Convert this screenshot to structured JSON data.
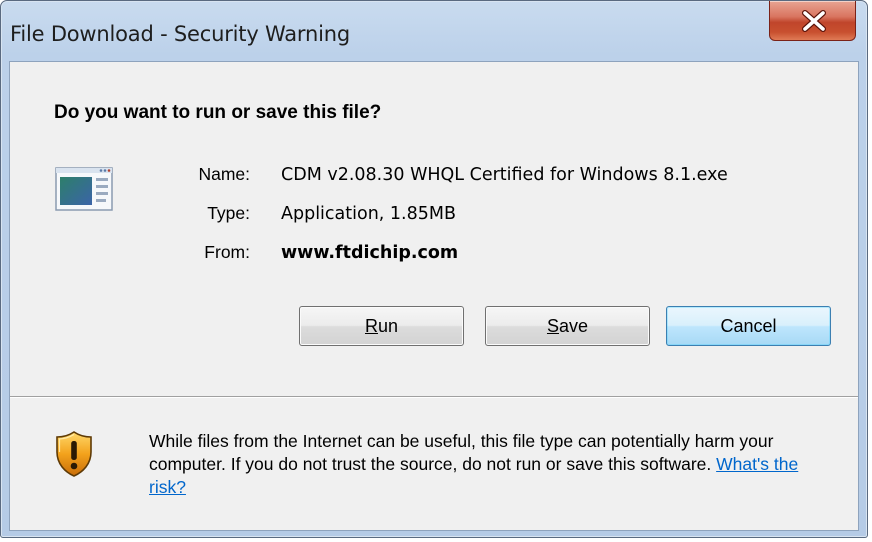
{
  "window": {
    "title": "File Download - Security Warning"
  },
  "dialog": {
    "question": "Do you want to run or save this file?",
    "fields": {
      "name_label": "Name:",
      "name_value": "CDM v2.08.30 WHQL Certified for Windows 8.1.exe",
      "type_label": "Type:",
      "type_value": "Application, 1.85MB",
      "from_label": "From:",
      "from_value": "www.ftdichip.com"
    },
    "buttons": {
      "run_mnemonic": "R",
      "run_rest": "un",
      "save_mnemonic": "S",
      "save_rest": "ave",
      "cancel": "Cancel"
    },
    "warning": {
      "text": "While files from the Internet can be useful, this file type can potentially harm your computer. If you do not trust the source, do not run or save this software.",
      "link": "What's the risk?"
    }
  },
  "icons": {
    "close": "close-icon",
    "application": "application-icon",
    "shield": "shield-warning-icon"
  },
  "colors": {
    "close_button": "#c7452c",
    "link": "#0066cc",
    "default_button_border": "#3c7fb1"
  }
}
